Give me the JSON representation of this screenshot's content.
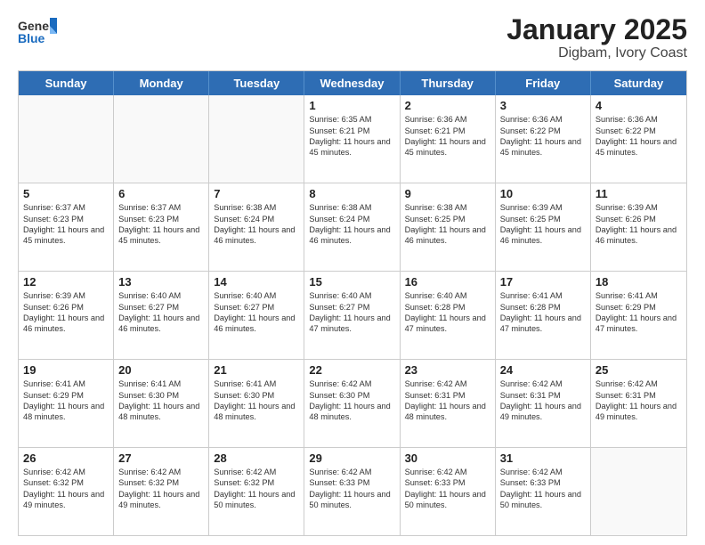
{
  "logo": {
    "general": "General",
    "blue": "Blue"
  },
  "title": "January 2025",
  "subtitle": "Digbam, Ivory Coast",
  "days": [
    "Sunday",
    "Monday",
    "Tuesday",
    "Wednesday",
    "Thursday",
    "Friday",
    "Saturday"
  ],
  "weeks": [
    [
      {
        "day": "",
        "info": ""
      },
      {
        "day": "",
        "info": ""
      },
      {
        "day": "",
        "info": ""
      },
      {
        "day": "1",
        "info": "Sunrise: 6:35 AM\nSunset: 6:21 PM\nDaylight: 11 hours and 45 minutes."
      },
      {
        "day": "2",
        "info": "Sunrise: 6:36 AM\nSunset: 6:21 PM\nDaylight: 11 hours and 45 minutes."
      },
      {
        "day": "3",
        "info": "Sunrise: 6:36 AM\nSunset: 6:22 PM\nDaylight: 11 hours and 45 minutes."
      },
      {
        "day": "4",
        "info": "Sunrise: 6:36 AM\nSunset: 6:22 PM\nDaylight: 11 hours and 45 minutes."
      }
    ],
    [
      {
        "day": "5",
        "info": "Sunrise: 6:37 AM\nSunset: 6:23 PM\nDaylight: 11 hours and 45 minutes."
      },
      {
        "day": "6",
        "info": "Sunrise: 6:37 AM\nSunset: 6:23 PM\nDaylight: 11 hours and 45 minutes."
      },
      {
        "day": "7",
        "info": "Sunrise: 6:38 AM\nSunset: 6:24 PM\nDaylight: 11 hours and 46 minutes."
      },
      {
        "day": "8",
        "info": "Sunrise: 6:38 AM\nSunset: 6:24 PM\nDaylight: 11 hours and 46 minutes."
      },
      {
        "day": "9",
        "info": "Sunrise: 6:38 AM\nSunset: 6:25 PM\nDaylight: 11 hours and 46 minutes."
      },
      {
        "day": "10",
        "info": "Sunrise: 6:39 AM\nSunset: 6:25 PM\nDaylight: 11 hours and 46 minutes."
      },
      {
        "day": "11",
        "info": "Sunrise: 6:39 AM\nSunset: 6:26 PM\nDaylight: 11 hours and 46 minutes."
      }
    ],
    [
      {
        "day": "12",
        "info": "Sunrise: 6:39 AM\nSunset: 6:26 PM\nDaylight: 11 hours and 46 minutes."
      },
      {
        "day": "13",
        "info": "Sunrise: 6:40 AM\nSunset: 6:27 PM\nDaylight: 11 hours and 46 minutes."
      },
      {
        "day": "14",
        "info": "Sunrise: 6:40 AM\nSunset: 6:27 PM\nDaylight: 11 hours and 46 minutes."
      },
      {
        "day": "15",
        "info": "Sunrise: 6:40 AM\nSunset: 6:27 PM\nDaylight: 11 hours and 47 minutes."
      },
      {
        "day": "16",
        "info": "Sunrise: 6:40 AM\nSunset: 6:28 PM\nDaylight: 11 hours and 47 minutes."
      },
      {
        "day": "17",
        "info": "Sunrise: 6:41 AM\nSunset: 6:28 PM\nDaylight: 11 hours and 47 minutes."
      },
      {
        "day": "18",
        "info": "Sunrise: 6:41 AM\nSunset: 6:29 PM\nDaylight: 11 hours and 47 minutes."
      }
    ],
    [
      {
        "day": "19",
        "info": "Sunrise: 6:41 AM\nSunset: 6:29 PM\nDaylight: 11 hours and 48 minutes."
      },
      {
        "day": "20",
        "info": "Sunrise: 6:41 AM\nSunset: 6:30 PM\nDaylight: 11 hours and 48 minutes."
      },
      {
        "day": "21",
        "info": "Sunrise: 6:41 AM\nSunset: 6:30 PM\nDaylight: 11 hours and 48 minutes."
      },
      {
        "day": "22",
        "info": "Sunrise: 6:42 AM\nSunset: 6:30 PM\nDaylight: 11 hours and 48 minutes."
      },
      {
        "day": "23",
        "info": "Sunrise: 6:42 AM\nSunset: 6:31 PM\nDaylight: 11 hours and 48 minutes."
      },
      {
        "day": "24",
        "info": "Sunrise: 6:42 AM\nSunset: 6:31 PM\nDaylight: 11 hours and 49 minutes."
      },
      {
        "day": "25",
        "info": "Sunrise: 6:42 AM\nSunset: 6:31 PM\nDaylight: 11 hours and 49 minutes."
      }
    ],
    [
      {
        "day": "26",
        "info": "Sunrise: 6:42 AM\nSunset: 6:32 PM\nDaylight: 11 hours and 49 minutes."
      },
      {
        "day": "27",
        "info": "Sunrise: 6:42 AM\nSunset: 6:32 PM\nDaylight: 11 hours and 49 minutes."
      },
      {
        "day": "28",
        "info": "Sunrise: 6:42 AM\nSunset: 6:32 PM\nDaylight: 11 hours and 50 minutes."
      },
      {
        "day": "29",
        "info": "Sunrise: 6:42 AM\nSunset: 6:33 PM\nDaylight: 11 hours and 50 minutes."
      },
      {
        "day": "30",
        "info": "Sunrise: 6:42 AM\nSunset: 6:33 PM\nDaylight: 11 hours and 50 minutes."
      },
      {
        "day": "31",
        "info": "Sunrise: 6:42 AM\nSunset: 6:33 PM\nDaylight: 11 hours and 50 minutes."
      },
      {
        "day": "",
        "info": ""
      }
    ]
  ]
}
